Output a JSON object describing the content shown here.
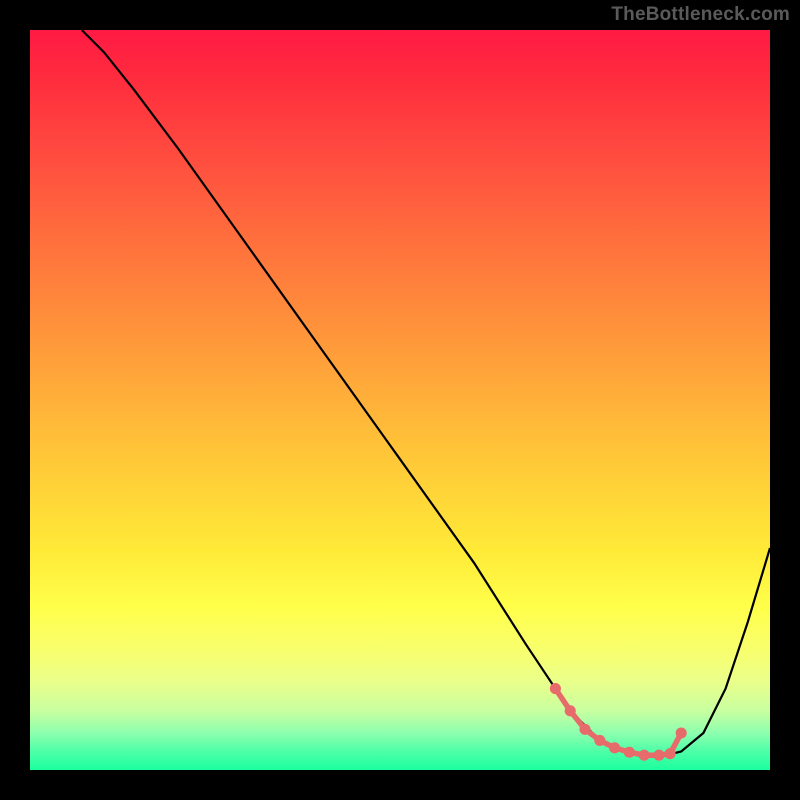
{
  "watermark": "TheBottleneck.com",
  "chart_data": {
    "type": "line",
    "title": "",
    "xlabel": "",
    "ylabel": "",
    "xlim": [
      0,
      100
    ],
    "ylim": [
      0,
      100
    ],
    "series": [
      {
        "name": "bottleneck-curve",
        "x": [
          7,
          10,
          14,
          20,
          30,
          40,
          50,
          60,
          67,
          71,
          74,
          77,
          80,
          83,
          86,
          88,
          91,
          94,
          97,
          100
        ],
        "y": [
          100,
          97,
          92,
          84,
          70,
          56,
          42,
          28,
          17,
          11,
          7,
          4,
          2.5,
          2,
          2,
          2.5,
          5,
          11,
          20,
          30
        ]
      }
    ],
    "highlight_points": {
      "name": "optimal-zone",
      "x": [
        71,
        73,
        75,
        77,
        79,
        81,
        83,
        85,
        86.5,
        88
      ],
      "y": [
        11,
        8,
        5.5,
        4,
        3,
        2.4,
        2,
        2,
        2.2,
        5
      ]
    }
  }
}
